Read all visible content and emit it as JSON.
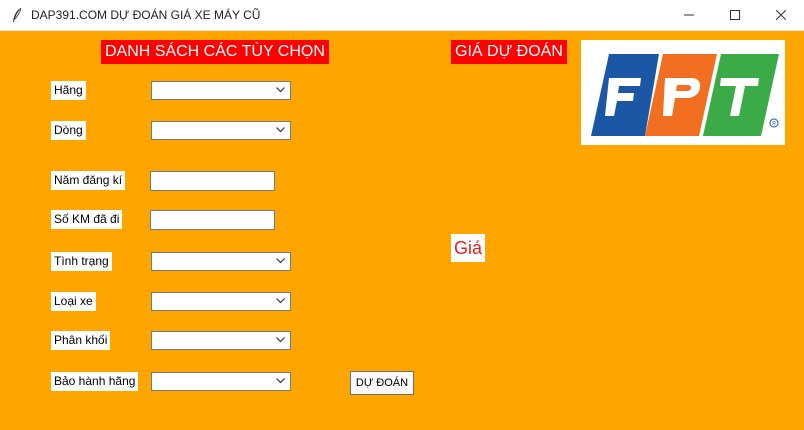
{
  "window": {
    "title": "DAP391.COM DỰ ĐOÁN GIÁ XE MÁY CŨ",
    "icons": [
      "feather-icon",
      "minimize-icon",
      "maximize-icon",
      "close-icon"
    ]
  },
  "headings": {
    "options": "DANH SÁCH CÁC TÙY CHỌN",
    "prediction": "GIÁ DỰ ĐOÁN"
  },
  "form": {
    "brand_label": "Hãng",
    "model_label": "Dòng",
    "year_label": "Năm đăng kí",
    "km_label": "Số KM đã đi",
    "condition_label": "Tình trạng",
    "type_label": "Loại xe",
    "engine_label": "Phân khối",
    "warranty_label": "Bảo hành hãng",
    "brand_value": "",
    "model_value": "",
    "year_value": "",
    "km_value": "",
    "condition_value": "",
    "type_value": "",
    "engine_value": "",
    "warranty_value": ""
  },
  "predict_button": "DỰ ĐOÁN",
  "price_label": "Giá",
  "logo": {
    "text": "FPT",
    "colors": {
      "f": "#1c57a6",
      "p": "#f26f21",
      "t": "#3aab47"
    }
  },
  "colors": {
    "background": "#ffa500",
    "heading": "#ff0000",
    "price_text": "#e0221a"
  }
}
